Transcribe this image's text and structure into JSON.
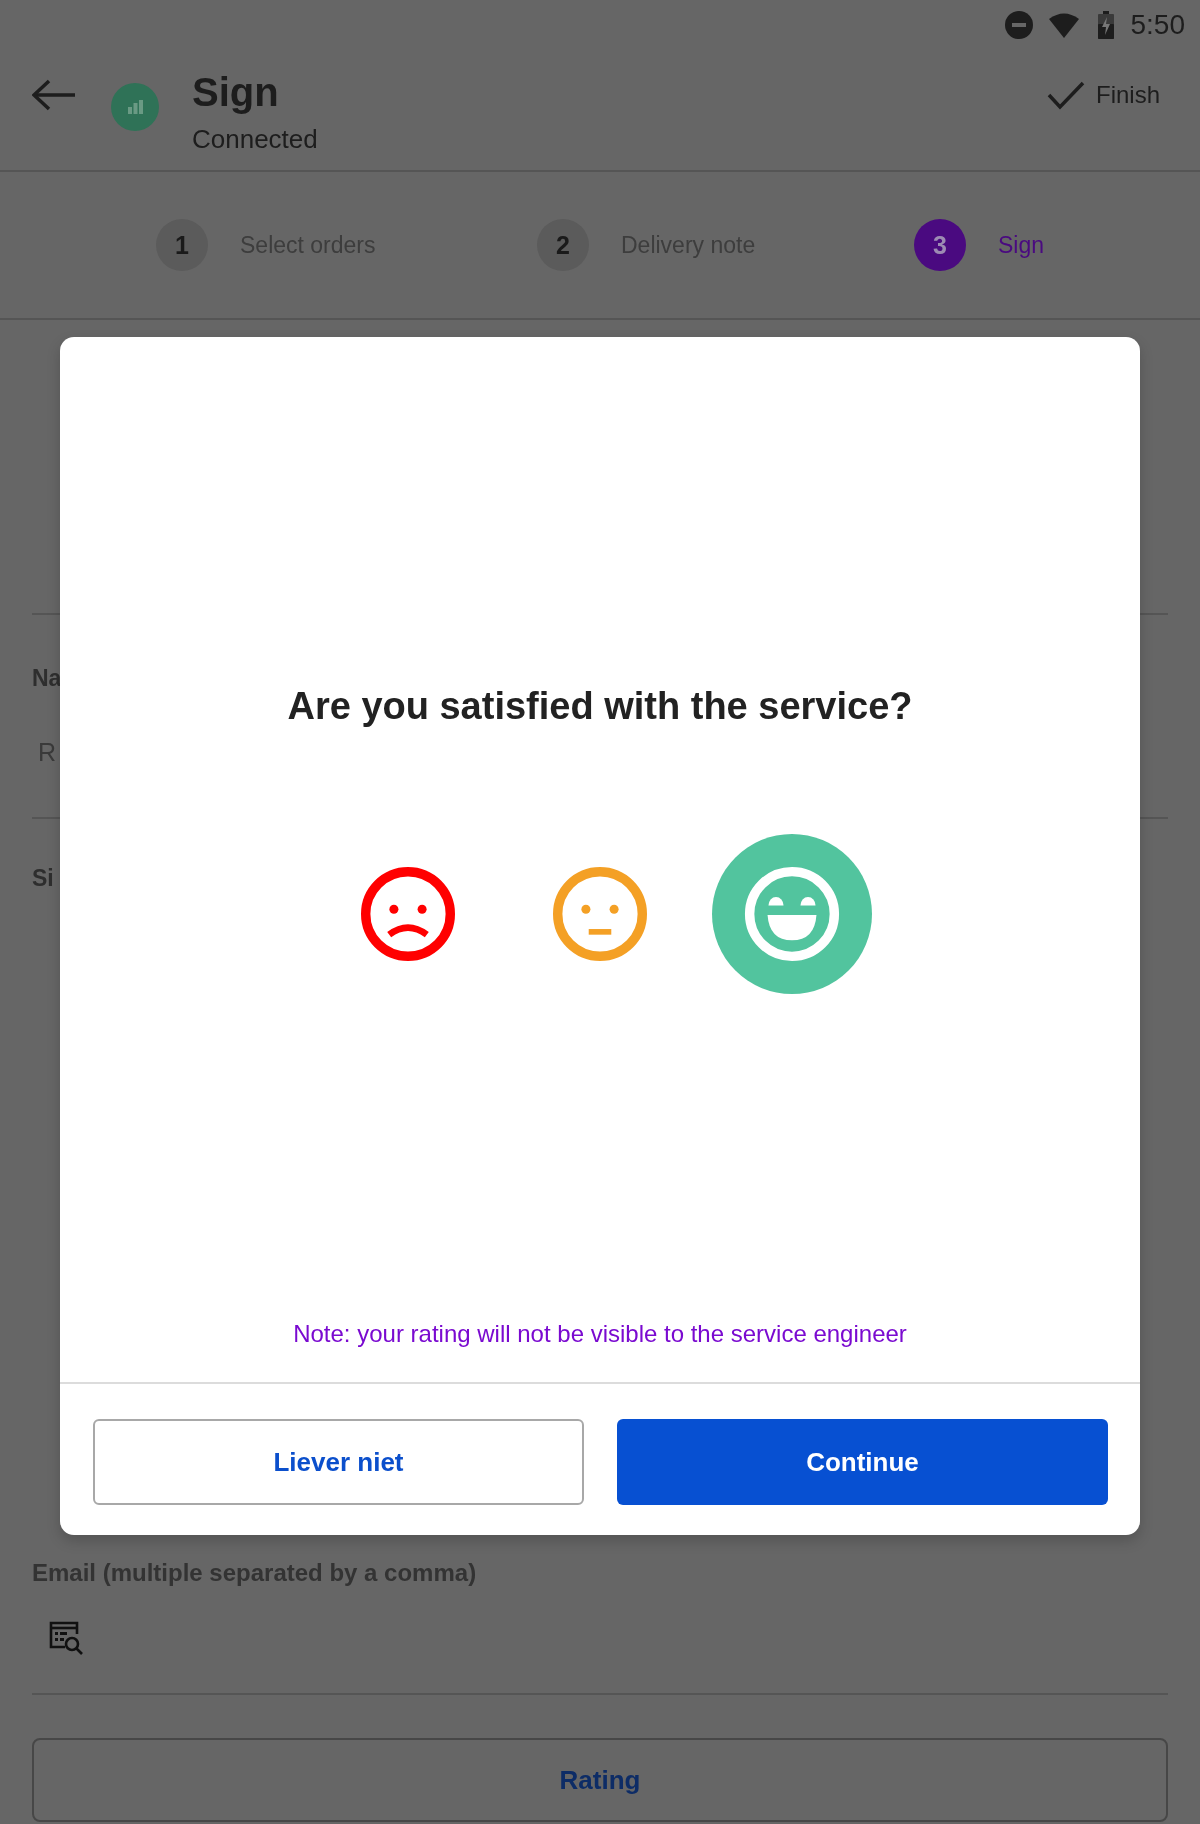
{
  "status_bar": {
    "time": "5:50"
  },
  "app_bar": {
    "title": "Sign",
    "subtitle": "Connected",
    "action": "Finish"
  },
  "stepper": {
    "steps": [
      {
        "number": "1",
        "label": "Select orders",
        "selected": false
      },
      {
        "number": "2",
        "label": "Delivery note",
        "selected": false
      },
      {
        "number": "3",
        "label": "Sign",
        "selected": true
      }
    ]
  },
  "form": {
    "name_label": "Na",
    "name_value": "R",
    "signature_label": "Si",
    "email_label": "Email (multiple separated by a comma)",
    "rating_button": "Rating"
  },
  "dialog": {
    "title": "Are you satisfied with the service?",
    "ratings": [
      {
        "kind": "sad",
        "color": "#ff0000",
        "selected": false
      },
      {
        "kind": "neutral",
        "color": "#f4a025",
        "selected": false
      },
      {
        "kind": "happy",
        "color": "#52c49e",
        "selected": true
      }
    ],
    "note": "Note: your rating will not be visible to the service engineer",
    "buttons": [
      {
        "label": "Liever niet",
        "kind": "secondary"
      },
      {
        "label": "Continue",
        "kind": "primary"
      }
    ]
  }
}
